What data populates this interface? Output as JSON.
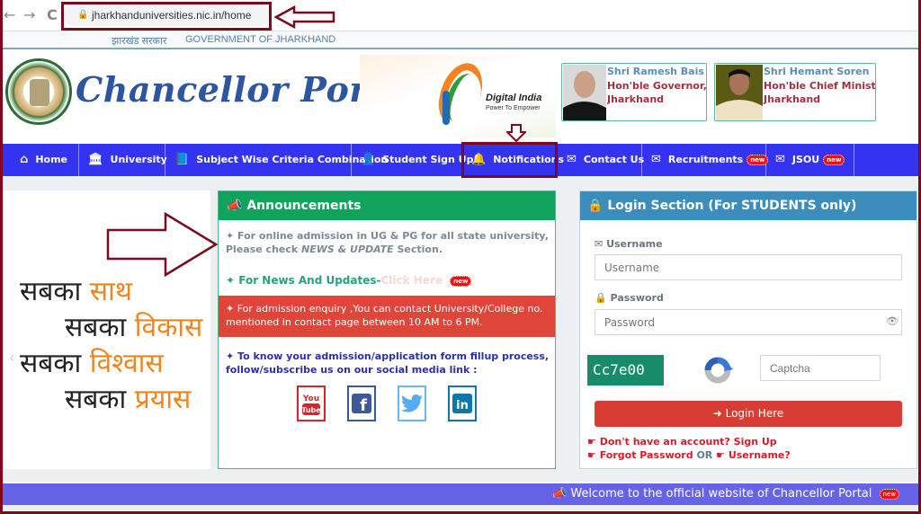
{
  "browser": {
    "back": "←",
    "forward": "→",
    "reload": "C",
    "url": "jharkhanduniversities.nic.in/home"
  },
  "gov_strip": {
    "hindi": "झारखंड सरकार",
    "english": "GOVERNMENT OF JHARKHAND"
  },
  "header": {
    "title": "Chancellor Portal",
    "digital_india": "Digital India",
    "digital_india_tagline": "Power To Empower",
    "leaders": [
      {
        "name": "Shri Ramesh Bais",
        "role_line1": "Hon'ble Governor,",
        "role_line2": "Jharkhand"
      },
      {
        "name": "Shri Hemant Soren",
        "role_line1": "Hon'ble Chief Ministe",
        "role_line2": "Jharkhand"
      }
    ]
  },
  "nav": {
    "items": [
      {
        "label": "Home",
        "icon": "home-icon"
      },
      {
        "label": "University",
        "icon": "institution-icon"
      },
      {
        "label": "Subject Wise Criteria Combination",
        "icon": "book-icon"
      },
      {
        "label": "Student Sign Up",
        "icon": "user-plus-icon"
      },
      {
        "label": "Notifications",
        "icon": "bell-icon"
      },
      {
        "label": "Contact Us",
        "icon": "envelope-icon"
      },
      {
        "label": "Recruitments",
        "icon": "envelope-icon",
        "badge": "new"
      },
      {
        "label": "JSOU",
        "icon": "envelope-icon",
        "badge": "new"
      }
    ]
  },
  "slogan": {
    "lines": [
      {
        "prefix": "सबका",
        "word": "साथ"
      },
      {
        "prefix": "सबका",
        "word": "विकास"
      },
      {
        "prefix": "सबका",
        "word": "विश्वास"
      },
      {
        "prefix": "सबका",
        "word": "प्रयास"
      }
    ]
  },
  "announcements": {
    "title": "Announcements",
    "p1_a": "✦ For online admission in UG & PG for all state university, Please check ",
    "p1_em": "NEWS & UPDATE",
    "p1_b": " Section.",
    "news_label": "✦ For News And Updates-",
    "news_link": "Click Here",
    "news_badge": "new",
    "enquiry": "✦ For admission enquiry ,You can contact University/College no. mentioned in contact page between 10 AM to 6 PM.",
    "social_text": "✦ To know your admission/application form fillup process, follow/subscribe us on our social media link :",
    "social": [
      {
        "name": "YouTube",
        "color": "#d8252a"
      },
      {
        "name": "Facebook",
        "color": "#3b5998"
      },
      {
        "name": "Twitter",
        "color": "#55acee"
      },
      {
        "name": "LinkedIn",
        "color": "#0e76a8"
      }
    ]
  },
  "login": {
    "title": "Login Section (For STUDENTS only)",
    "username_label": "Username",
    "username_placeholder": "Username",
    "password_label": "Password",
    "password_placeholder": "Password",
    "captcha_code": "Cc7e00",
    "captcha_placeholder": "Captcha",
    "button": "Login Here",
    "signup_link": "Don't have an account? Sign Up",
    "forgot_password": "Forgot Password",
    "or": "OR",
    "forgot_username": "Username?"
  },
  "footer": {
    "marquee": "Welcome to the official website of Chancellor Portal",
    "badge": "new"
  },
  "colors": {
    "nav_bg": "#3434f0",
    "announce_green": "#0fa35b",
    "login_blue": "#3c8dbc",
    "alert_red": "#e0453a",
    "annotation_maroon": "#7b0a1c",
    "footer_purple": "#6763e6"
  }
}
